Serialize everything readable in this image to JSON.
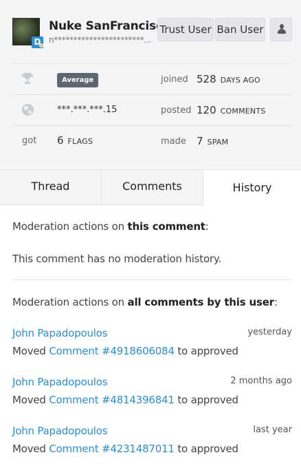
{
  "user": {
    "name": "Nuke SanFrancisco",
    "email_masked": "n***********************...",
    "avatar_badge": "D"
  },
  "actions": {
    "trust_label": "Trust User",
    "ban_label": "Ban User",
    "profile_icon": "person-icon"
  },
  "stats": {
    "rows": [
      {
        "left_icon": "trophy-icon",
        "left_value": "Average",
        "right_label": "joined",
        "right_number": "528",
        "right_unit": "DAYS AGO"
      },
      {
        "left_icon": "globe-icon",
        "left_value": "***.***.***.15",
        "right_label": "posted",
        "right_number": "120",
        "right_unit": "COMMENTS"
      },
      {
        "left_label": "got",
        "left_number": "6",
        "left_unit": "FLAGS",
        "right_label": "made",
        "right_number": "7",
        "right_unit": "SPAM"
      }
    ]
  },
  "tabs": [
    {
      "label": "Thread",
      "active": false
    },
    {
      "label": "Comments",
      "active": false
    },
    {
      "label": "History",
      "active": true
    }
  ],
  "history": {
    "this_comment_prefix": "Moderation actions on ",
    "this_comment_bold": "this comment",
    "this_comment_suffix": ":",
    "no_history": "This comment has no moderation history.",
    "all_prefix": "Moderation actions on ",
    "all_bold": "all comments by this user",
    "all_suffix": ":",
    "entries": [
      {
        "moderator": "John Papadopoulos",
        "when": "yesterday",
        "verb": "Moved ",
        "link": "Comment #4918606084",
        "result": " to approved"
      },
      {
        "moderator": "John Papadopoulos",
        "when": "2 months ago",
        "verb": "Moved ",
        "link": "Comment #4814396841",
        "result": " to approved"
      },
      {
        "moderator": "John Papadopoulos",
        "when": "last year",
        "verb": "Moved ",
        "link": "Comment #4231487011",
        "result": " to approved"
      }
    ]
  },
  "colors": {
    "link": "#2a8fd4",
    "badge_bg": "#5e6670",
    "header_bg": "#f4f5f6"
  }
}
